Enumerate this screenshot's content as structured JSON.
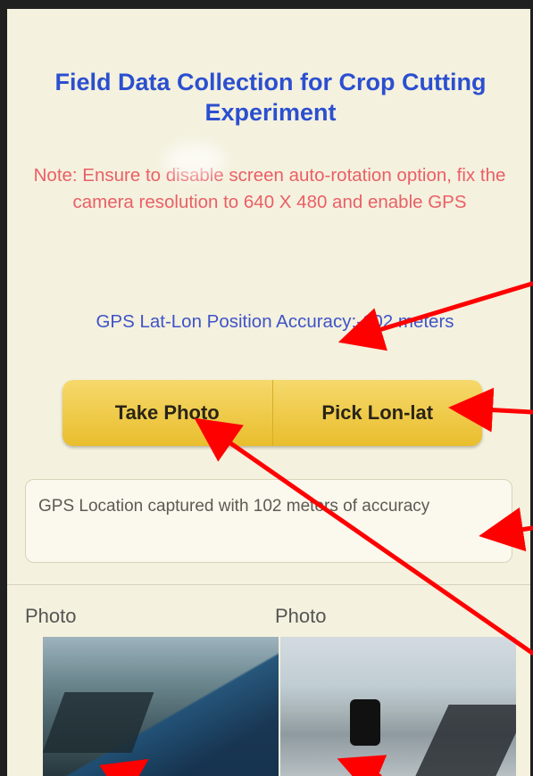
{
  "header": {
    "title": "Field Data Collection for Crop Cutting Experiment"
  },
  "note": {
    "text": "Note: Ensure to disable screen auto-rotation option, fix the camera resolution to 640 X 480 and enable GPS"
  },
  "gps": {
    "accuracy_text": "GPS Lat-Lon Position Accuracy:-102 meters",
    "status_text": "GPS Location captured with 102 meters of accuracy"
  },
  "buttons": {
    "take_photo": "Take Photo",
    "pick_lonlat": "Pick Lon-lat"
  },
  "photos": {
    "label_left": "Photo",
    "label_right": "Photo"
  },
  "colors": {
    "title": "#2b4fd0",
    "note": "#ea5f66",
    "accuracy": "#3f54c8",
    "button": "#e9be2d",
    "arrow": "#ff0000"
  }
}
